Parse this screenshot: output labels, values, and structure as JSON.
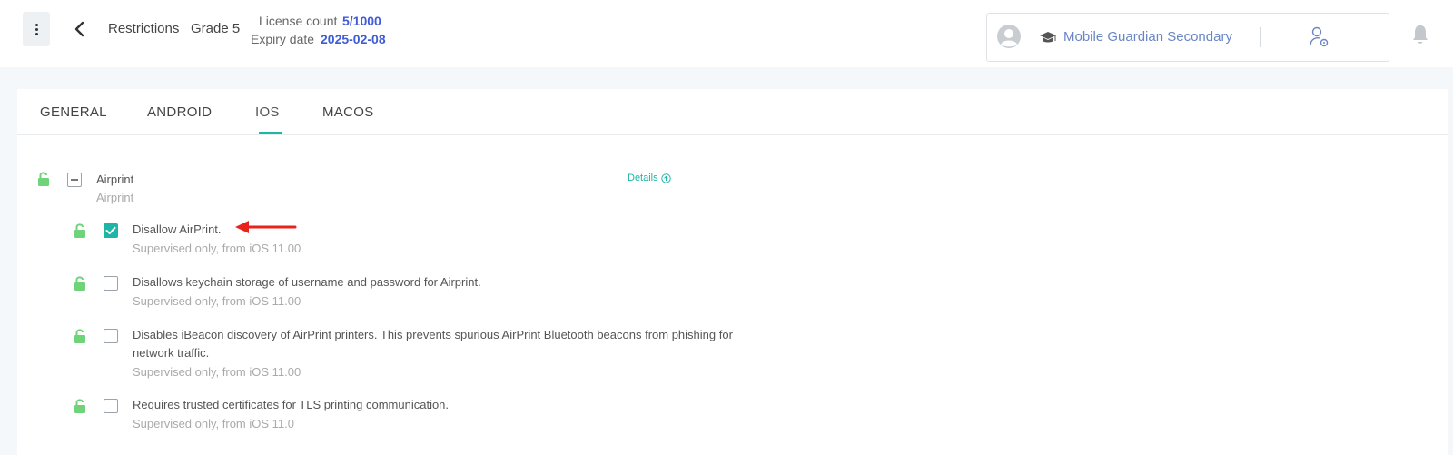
{
  "header": {
    "breadcrumb_title": "Restrictions",
    "breadcrumb_group": "Grade 5",
    "license_label": "License count",
    "license_value": "5/1000",
    "expiry_label": "Expiry date",
    "expiry_value": "2025-02-08"
  },
  "account": {
    "name": "Mobile Guardian Secondary",
    "avatar_icon": "user-avatar-icon",
    "school_icon": "graduation-cap-icon",
    "settings_icon": "user-settings-icon",
    "notification_icon": "bell-icon"
  },
  "tabs": [
    {
      "label": "GENERAL",
      "active": false
    },
    {
      "label": "ANDROID",
      "active": false
    },
    {
      "label": "IOS",
      "active": true
    },
    {
      "label": "MACOS",
      "active": false
    }
  ],
  "group": {
    "title": "Airprint",
    "subtitle": "Airprint",
    "details_label": "Details",
    "expanded": true
  },
  "items": [
    {
      "title": "Disallow AirPrint.",
      "subtitle": "Supervised only, from iOS 11.00",
      "checked": true
    },
    {
      "title": "Disallows keychain storage of username and password for Airprint.",
      "subtitle": "Supervised only, from iOS 11.00",
      "checked": false
    },
    {
      "title": "Disables iBeacon discovery of AirPrint printers. This prevents spurious AirPrint Bluetooth beacons from phishing for network traffic.",
      "subtitle": "Supervised only, from iOS 11.00",
      "checked": false
    },
    {
      "title": "Requires trusted certificates for TLS printing communication.",
      "subtitle": "Supervised only, from iOS 11.0",
      "checked": false
    }
  ],
  "colors": {
    "accent": "#1fb5a6",
    "lock": "#6fd37a",
    "link_blue": "#3f5bd6",
    "annotation_arrow": "#e8231c"
  }
}
